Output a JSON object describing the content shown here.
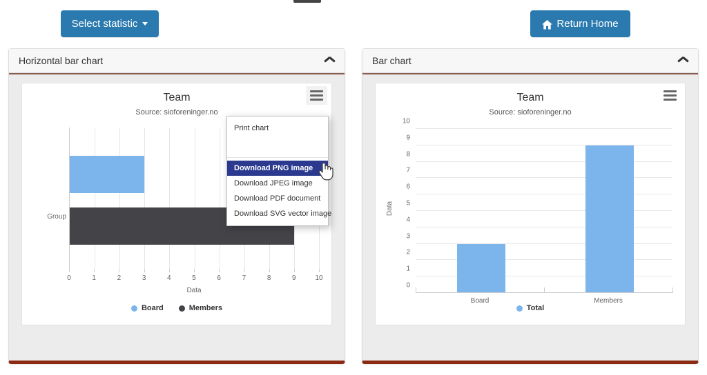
{
  "toolbar": {
    "select_statistic_label": "Select statistic",
    "return_home_label": "Return Home"
  },
  "accent_color": "#2a7ab0",
  "panel_accent_color": "#8a2a12",
  "panels": [
    {
      "title": "Horizontal bar chart",
      "collapse_icon": "chevron-up-icon"
    },
    {
      "title": "Bar chart",
      "collapse_icon": "chevron-up-icon"
    }
  ],
  "context_menu": {
    "items": [
      {
        "label": "Print chart",
        "highlighted": false
      },
      {
        "label": "Download PNG image",
        "highlighted": true
      },
      {
        "label": "Download JPEG image",
        "highlighted": false
      },
      {
        "label": "Download PDF document",
        "highlighted": false
      },
      {
        "label": "Download SVG vector image",
        "highlighted": false
      }
    ],
    "highlight_color": "#2b3a8f"
  },
  "chart_data": [
    {
      "type": "bar",
      "orientation": "horizontal",
      "title": "Team",
      "subtitle": "Source: sioforeninger.no",
      "categories": [
        "Group"
      ],
      "series": [
        {
          "name": "Board",
          "values": [
            3
          ],
          "color": "#7cb5ec"
        },
        {
          "name": "Members",
          "values": [
            9
          ],
          "color": "#434348"
        }
      ],
      "xlabel": "Data",
      "ylabel": "",
      "xticks": [
        0,
        1,
        2,
        3,
        4,
        5,
        6,
        7,
        8,
        9,
        10
      ],
      "xlim": [
        0,
        10
      ],
      "grid": true,
      "legend_position": "bottom"
    },
    {
      "type": "bar",
      "orientation": "vertical",
      "title": "Team",
      "subtitle": "Source: sioforeninger.no",
      "categories": [
        "Board",
        "Members"
      ],
      "series": [
        {
          "name": "Total",
          "values": [
            3,
            9
          ],
          "color": "#7cb5ec"
        }
      ],
      "xlabel": "",
      "ylabel": "Data",
      "yticks": [
        0,
        1,
        2,
        3,
        4,
        5,
        6,
        7,
        8,
        9,
        10
      ],
      "ylim": [
        0,
        10
      ],
      "grid": true,
      "legend_position": "bottom"
    }
  ]
}
